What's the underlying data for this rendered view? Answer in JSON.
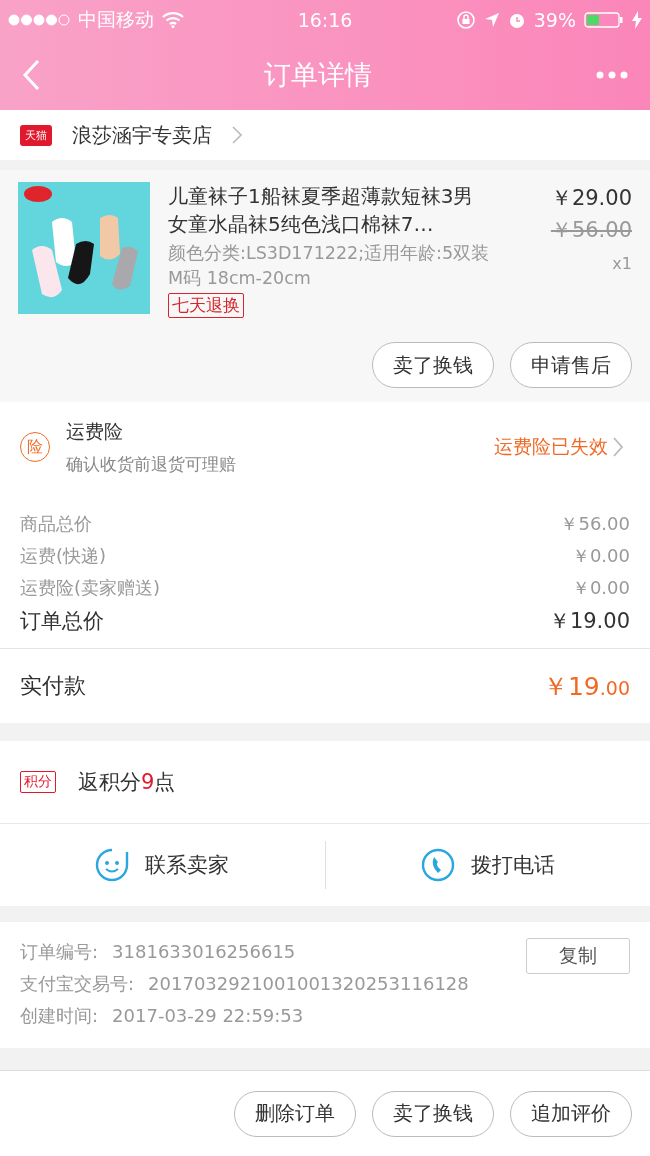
{
  "status_bar": {
    "carrier": "中国移动",
    "time": "16:16",
    "battery": "39%"
  },
  "nav": {
    "title": "订单详情"
  },
  "shop": {
    "badge": "天猫",
    "name": "浪莎涵宇专卖店"
  },
  "product": {
    "title": "儿童袜子1船袜夏季超薄款短袜3男女童水晶袜5纯色浅口棉袜7…",
    "sku": "颜色分类:LS3D171222;适用年龄:5双装M码 18cm-20cm",
    "tag": "七天退换",
    "price": "￥29.00",
    "original_price": "￥56.00",
    "quantity": "x1",
    "buttons": [
      "卖了换钱",
      "申请售后"
    ]
  },
  "insurance": {
    "icon": "险",
    "title": "运费险",
    "subtitle": "确认收货前退货可理赔",
    "status": "运费险已失效"
  },
  "costs": [
    {
      "label": "商品总价",
      "value": "￥56.00"
    },
    {
      "label": "运费(快递)",
      "value": "￥0.00"
    },
    {
      "label": "运费险(卖家赠送)",
      "value": "￥0.00"
    }
  ],
  "total": {
    "label": "订单总价",
    "value": "￥19.00"
  },
  "paid": {
    "label": "实付款",
    "amount": "￥19",
    "cents": ".00"
  },
  "points": {
    "badge": "积分",
    "text": "返积分**9**点"
  },
  "contact": [
    {
      "label": "联系卖家"
    },
    {
      "label": "拨打电话"
    }
  ],
  "info": {
    "rows": [
      {
        "label": "订单编号:",
        "value": "3181633016256615"
      },
      {
        "label": "支付宝交易号:",
        "value": "2017032921001001320253116128"
      },
      {
        "label": "创建时间:",
        "value": "2017-03-29 22:59:53"
      }
    ],
    "copy_button": "复制"
  },
  "actions": [
    "删除订单",
    "卖了换钱",
    "追加评价"
  ]
}
